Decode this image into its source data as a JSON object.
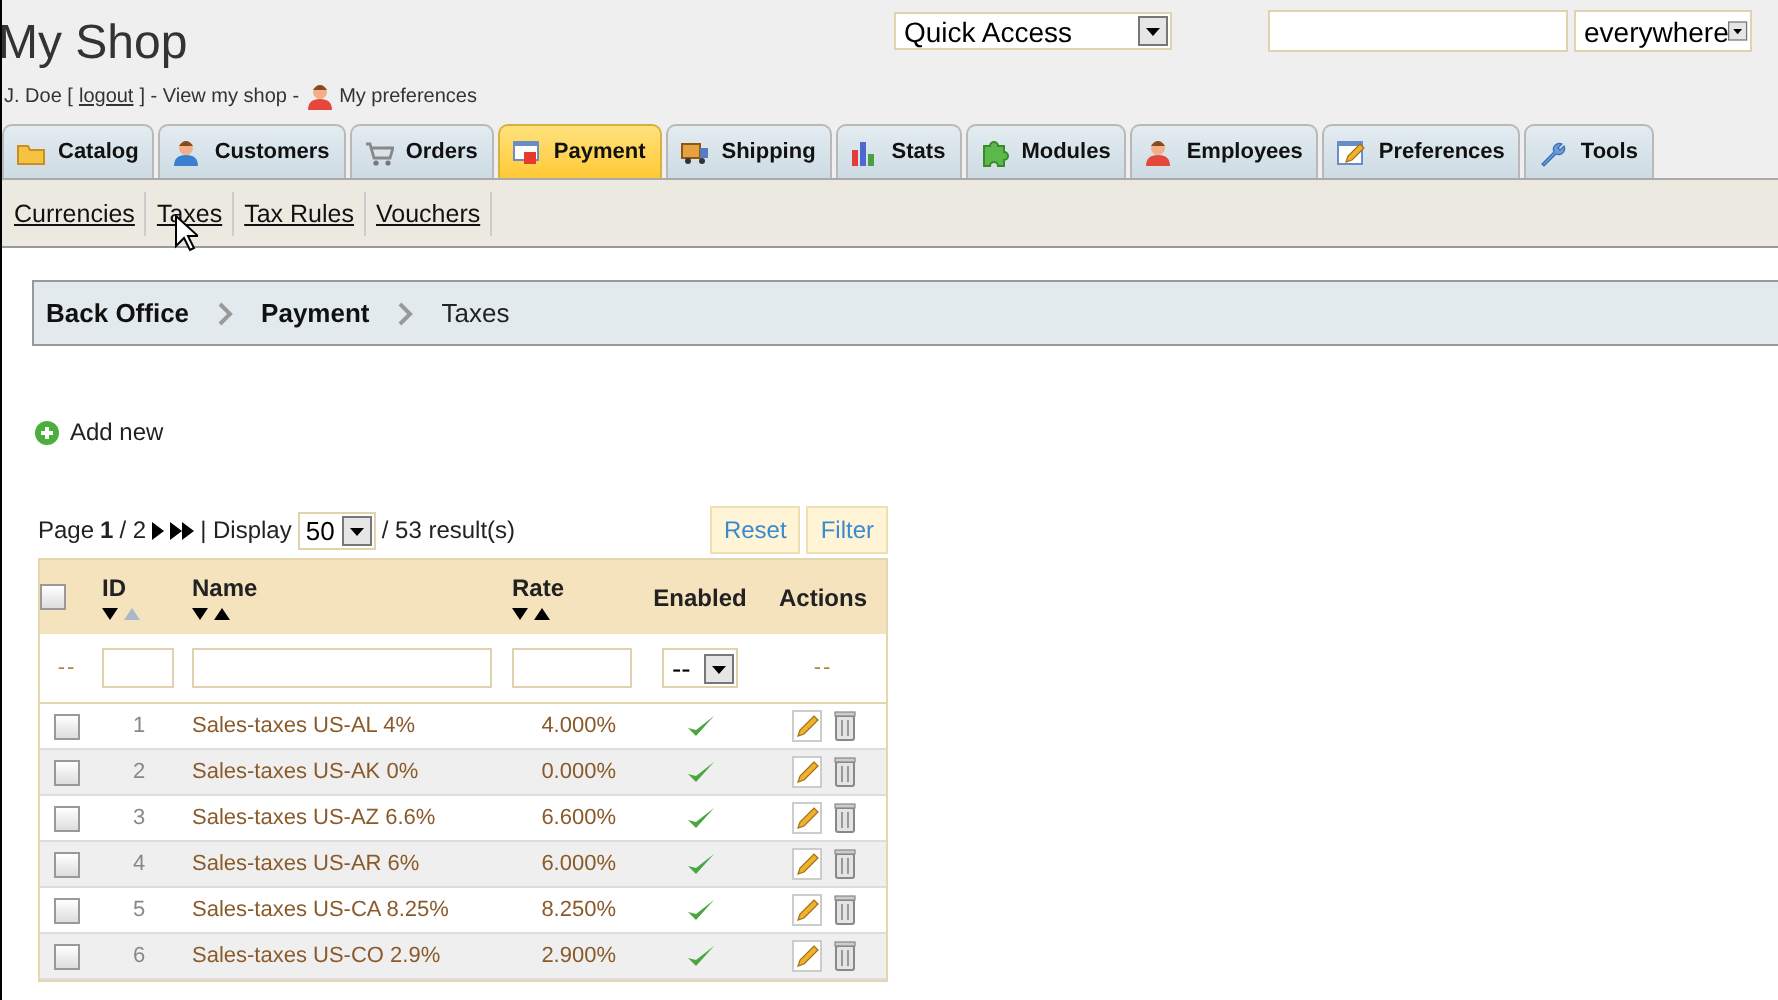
{
  "shop_title": "My Shop",
  "user_bar": {
    "name": "J. Doe [",
    "logout": "logout",
    "after_logout": "] - View my shop -",
    "preferences": "My preferences"
  },
  "quick_access": {
    "value": "Quick Access"
  },
  "search": {
    "scope": "everywhere"
  },
  "tabs": [
    {
      "label": "Catalog",
      "selected": false
    },
    {
      "label": "Customers",
      "selected": false
    },
    {
      "label": "Orders",
      "selected": false
    },
    {
      "label": "Payment",
      "selected": true
    },
    {
      "label": "Shipping",
      "selected": false
    },
    {
      "label": "Stats",
      "selected": false
    },
    {
      "label": "Modules",
      "selected": false
    },
    {
      "label": "Employees",
      "selected": false
    },
    {
      "label": "Preferences",
      "selected": false
    },
    {
      "label": "Tools",
      "selected": false
    }
  ],
  "subtabs": [
    {
      "label": "Currencies"
    },
    {
      "label": "Taxes"
    },
    {
      "label": "Tax Rules"
    },
    {
      "label": "Vouchers"
    }
  ],
  "breadcrumb": [
    "Back Office",
    "Payment",
    "Taxes"
  ],
  "add_new": "Add new",
  "pagination": {
    "page_label": "Page",
    "page": "1",
    "of": "/ 2",
    "display": "| Display",
    "per_page": "50",
    "results": "/ 53 result(s)"
  },
  "filter_buttons": [
    "Reset",
    "Filter"
  ],
  "table": {
    "all_checked": false,
    "columns": [
      "ID",
      "Name",
      "Rate",
      "Enabled",
      "Actions"
    ],
    "filter_row": {
      "lead": "--",
      "enabled_value": "--",
      "actions": "--"
    },
    "rows": [
      {
        "id": "1",
        "name": "Sales-taxes US-AL 4%",
        "rate": "4.000%",
        "enabled": true,
        "checked": false
      },
      {
        "id": "2",
        "name": "Sales-taxes US-AK 0%",
        "rate": "0.000%",
        "enabled": true,
        "checked": false
      },
      {
        "id": "3",
        "name": "Sales-taxes US-AZ 6.6%",
        "rate": "6.600%",
        "enabled": true,
        "checked": false
      },
      {
        "id": "4",
        "name": "Sales-taxes US-AR 6%",
        "rate": "6.000%",
        "enabled": true,
        "checked": false
      },
      {
        "id": "5",
        "name": "Sales-taxes US-CA 8.25%",
        "rate": "8.250%",
        "enabled": true,
        "checked": false
      },
      {
        "id": "6",
        "name": "Sales-taxes US-CO 2.9%",
        "rate": "2.900%",
        "enabled": true,
        "checked": false
      }
    ]
  }
}
